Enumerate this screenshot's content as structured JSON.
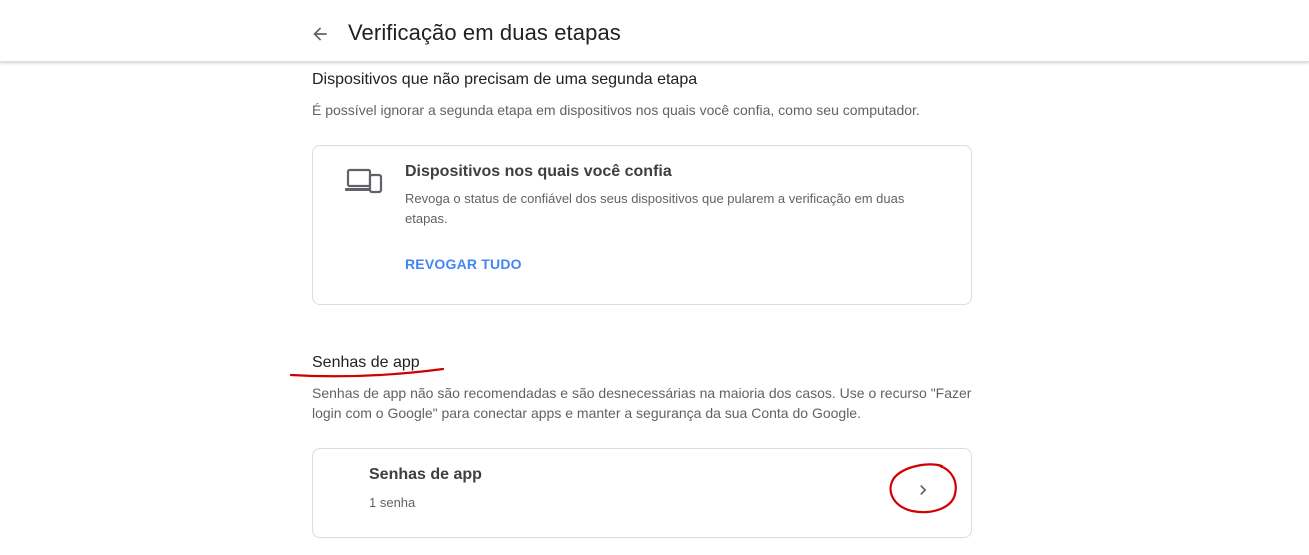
{
  "header": {
    "back_icon": "arrow-back-icon",
    "title": "Verificação em duas etapas"
  },
  "trusted_devices_section": {
    "heading": "Dispositivos que não precisam de uma segunda etapa",
    "description": "É possível ignorar a segunda etapa em dispositivos nos quais você confia, como seu computador.",
    "card": {
      "icon": "devices-icon",
      "title": "Dispositivos nos quais você confia",
      "description": "Revoga o status de confiável dos seus dispositivos que pularem a verificação em duas etapas.",
      "action_label": "REVOGAR TUDO"
    }
  },
  "app_passwords_section": {
    "heading": "Senhas de app",
    "description": "Senhas de app não são recomendadas e são desnecessárias na maioria dos casos. Use o recurso \"Fazer login com o Google\" para conectar apps e manter a segurança da sua Conta do Google.",
    "card": {
      "title": "Senhas de app",
      "count": "1 senha",
      "chevron_icon": "chevron-right-icon"
    }
  },
  "colors": {
    "link": "#4285f4",
    "annotation": "#d00000",
    "border": "#dadce0"
  }
}
